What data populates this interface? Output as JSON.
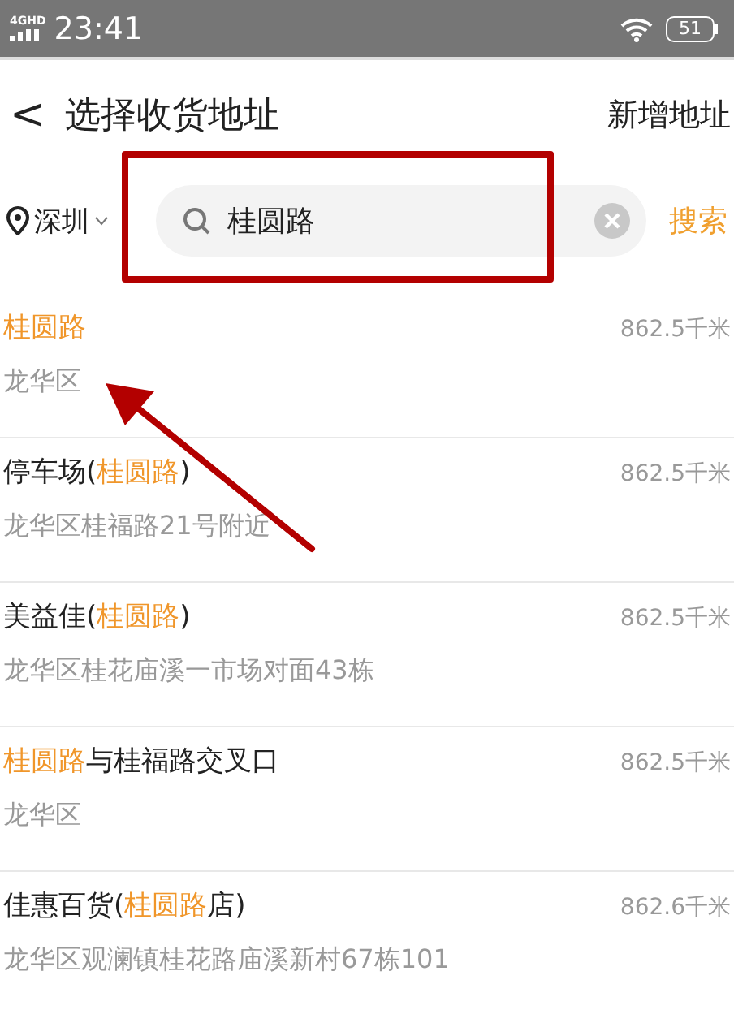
{
  "status_bar": {
    "network": "4GHD",
    "time": "23:41",
    "battery": "51"
  },
  "header": {
    "back": "<",
    "title": "选择收货地址",
    "action": "新增地址"
  },
  "search": {
    "city": "深圳",
    "value": "桂圆路",
    "button": "搜索"
  },
  "results": [
    {
      "name": [
        {
          "text": "桂圆路",
          "highlight": true
        }
      ],
      "distance": "862.5千米",
      "address": "龙华区"
    },
    {
      "name": [
        {
          "text": "停车场(",
          "highlight": false
        },
        {
          "text": "桂圆路",
          "highlight": true
        },
        {
          "text": ")",
          "highlight": false
        }
      ],
      "distance": "862.5千米",
      "address": "龙华区桂福路21号附近"
    },
    {
      "name": [
        {
          "text": "美益佳(",
          "highlight": false
        },
        {
          "text": "桂圆路",
          "highlight": true
        },
        {
          "text": ")",
          "highlight": false
        }
      ],
      "distance": "862.5千米",
      "address": "龙华区桂花庙溪一市场对面43栋"
    },
    {
      "name": [
        {
          "text": "桂圆路",
          "highlight": true
        },
        {
          "text": "与桂福路交叉口",
          "highlight": false
        }
      ],
      "distance": "862.5千米",
      "address": "龙华区"
    },
    {
      "name": [
        {
          "text": "佳惠百货(",
          "highlight": false
        },
        {
          "text": "桂圆路",
          "highlight": true
        },
        {
          "text": "店)",
          "highlight": false
        }
      ],
      "distance": "862.6千米",
      "address": "龙华区观澜镇桂花路庙溪新村67栋101"
    }
  ],
  "annotations": {
    "highlight_box": true,
    "pointer_arrow": true
  }
}
